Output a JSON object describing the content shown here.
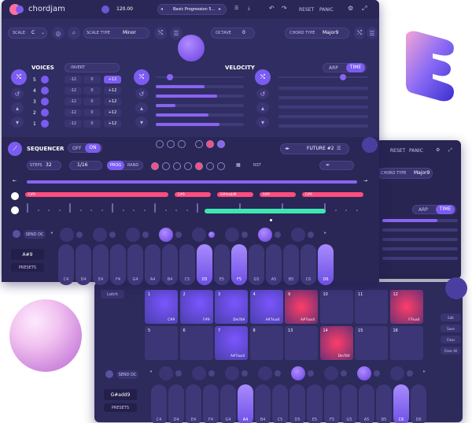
{
  "app": {
    "logo_text": "chordjam",
    "tempo": "120.00",
    "progression_name": "Basic Progression 5...",
    "reset_label": "RESET",
    "panic_label": "PANIC"
  },
  "scale_bar": {
    "scale_label": "SCALE",
    "scale_value": "C",
    "scale_type_label": "SCALE TYPE",
    "scale_type_value": "Minor",
    "octave_label": "OCTAVE",
    "octave_value": "0",
    "chord_type_label": "CHORD TYPE",
    "chord_type_value": "Major9"
  },
  "voices": {
    "title": "VOICES",
    "invert_label": "INVERT",
    "rows": [
      {
        "num": "5",
        "a": "-12",
        "b": "0",
        "c": "+12"
      },
      {
        "num": "4",
        "a": "-12",
        "b": "0",
        "c": "+12"
      },
      {
        "num": "3",
        "a": "-12",
        "b": "0",
        "c": "+12"
      },
      {
        "num": "2",
        "a": "-12",
        "b": "0",
        "c": "+12"
      },
      {
        "num": "1",
        "a": "-12",
        "b": "0",
        "c": "+12"
      }
    ]
  },
  "velocity": {
    "title": "VELOCITY",
    "levels": [
      0.55,
      0.7,
      0.22,
      0.6,
      0.72
    ]
  },
  "arp": {
    "arp_label": "ARP",
    "time_label": "TIME"
  },
  "sequencer": {
    "title": "SEQUENCER",
    "off_label": "OFF",
    "on_label": "ON",
    "preset_name": "FUTURE #2",
    "steps_label": "STEPS",
    "steps_value": "32",
    "rate_value": "1/16",
    "prog_label": "PROG",
    "rand_label": "RAND",
    "rst_label": "RST",
    "chord_bars": [
      "C#9",
      "C#9",
      "G#madd9",
      "A#9",
      "C#9"
    ]
  },
  "keyboard_top": {
    "send_label": "SEND DC",
    "chord_name": "A#9",
    "presets_label": "PRESETS",
    "keys": [
      "C4",
      "D4",
      "E4",
      "F4",
      "G4",
      "A4",
      "B4",
      "C5",
      "D5",
      "E5",
      "F5",
      "G5",
      "A5",
      "B5",
      "C6",
      "D6"
    ],
    "active": [
      "D5",
      "F5",
      "D6"
    ]
  },
  "pads": {
    "latch_label": "Latch",
    "items": [
      {
        "num": "1",
        "label": "C#9"
      },
      {
        "num": "2",
        "label": "F#9"
      },
      {
        "num": "3",
        "label": "Dm7b9"
      },
      {
        "num": "4",
        "label": "A#7sus4"
      },
      {
        "num": "9",
        "label": "A#7sus4"
      },
      {
        "num": "10",
        "label": ""
      },
      {
        "num": "11",
        "label": ""
      },
      {
        "num": "12",
        "label": "F7sus4"
      },
      {
        "num": "5",
        "label": ""
      },
      {
        "num": "6",
        "label": ""
      },
      {
        "num": "7",
        "label": "A#7sus4"
      },
      {
        "num": "8",
        "label": ""
      },
      {
        "num": "13",
        "label": ""
      },
      {
        "num": "14",
        "label": "Dm7b9"
      },
      {
        "num": "15",
        "label": ""
      },
      {
        "num": "16",
        "label": ""
      }
    ],
    "side_buttons": [
      "Edit",
      "Save",
      "Clear",
      "Clear All"
    ]
  },
  "keyboard_bottom": {
    "send_label": "SEND DC",
    "chord_name": "G#add9",
    "presets_label": "PRESETS",
    "keys": [
      "C4",
      "D4",
      "E4",
      "F4",
      "G4",
      "A4",
      "B4",
      "C5",
      "D5",
      "E5",
      "F5",
      "G5",
      "A5",
      "B5",
      "C6",
      "D6"
    ],
    "active": [
      "A4",
      "C6"
    ]
  },
  "back_panel": {
    "reset_label": "RESET",
    "panic_label": "PANIC",
    "chord_type_label": "CHORD TYPE",
    "chord_type_value": "Major9",
    "arp_label": "ARP",
    "time_label": "TIME"
  },
  "colors": {
    "accent": "#7b5cf0",
    "pink": "#ff4d7d",
    "green": "#3ee6b0",
    "panel": "#2d2a5c"
  }
}
